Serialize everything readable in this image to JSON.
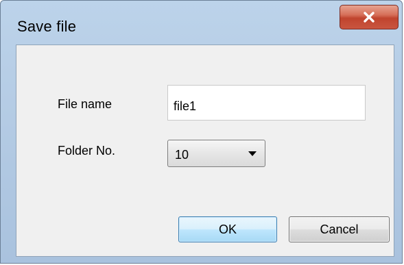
{
  "window": {
    "title": "Save file",
    "close_icon": "close-icon"
  },
  "form": {
    "file_name_label": "File name",
    "file_name_value": "file1",
    "folder_label": "Folder No.",
    "folder_value": "10"
  },
  "buttons": {
    "ok_label": "OK",
    "cancel_label": "Cancel"
  },
  "colors": {
    "frame": "#b4cbe4",
    "close_button": "#c9553f",
    "dialog_background": "#f0f0f0",
    "default_button_border": "#3c7fb1"
  }
}
